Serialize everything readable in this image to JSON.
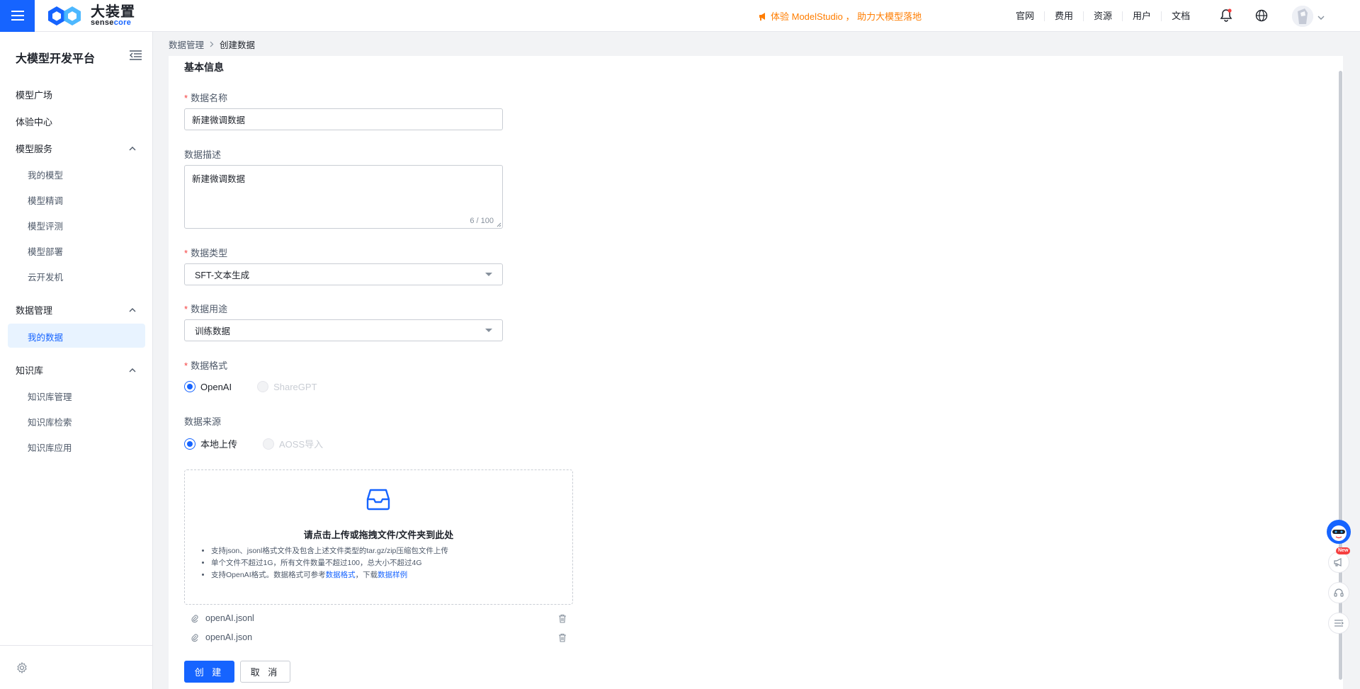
{
  "header": {
    "logo_cn": "大装置",
    "logo_en_a": "sense",
    "logo_en_b": "core",
    "promo": "体验 ModelStudio ， 助力大模型落地",
    "nav": [
      "官网",
      "费用",
      "资源",
      "用户",
      "文档"
    ],
    "accent": "#1664ff",
    "promo_color": "#ff7d00"
  },
  "sidebar": {
    "title": "大模型开发平台",
    "items": {
      "model_square": "模型广场",
      "experience": "体验中心",
      "model_service": "模型服务",
      "my_model": "我的模型",
      "fine_tune": "模型精调",
      "evaluation": "模型评测",
      "deploy": "模型部署",
      "cloud_dev": "云开发机",
      "data_mgmt": "数据管理",
      "my_data": "我的数据",
      "knowledge": "知识库",
      "kb_mgmt": "知识库管理",
      "kb_search": "知识库检索",
      "kb_app": "知识库应用"
    }
  },
  "breadcrumb": {
    "parent": "数据管理",
    "separator": ">",
    "current": "创建数据"
  },
  "form": {
    "section_title": "基本信息",
    "required_mark": "*",
    "name_label": "数据名称",
    "name_value": "新建微调数据",
    "desc_label": "数据描述",
    "desc_value": "新建微调数据",
    "desc_counter": "6 / 100",
    "type_label": "数据类型",
    "type_value": "SFT-文本生成",
    "usage_label": "数据用途",
    "usage_value": "训练数据",
    "format_label": "数据格式",
    "format_options": [
      "OpenAI",
      "ShareGPT"
    ],
    "source_label": "数据来源",
    "source_options": [
      "本地上传",
      "AOSS导入"
    ]
  },
  "upload": {
    "title": "请点击上传或拖拽文件/文件夹到此处",
    "tip1": "支持json、jsonl格式文件及包含上述文件类型的tar.gz/zip压缩包文件上传",
    "tip2": "单个文件不超过1G，所有文件数量不超过100，总大小不超过4G",
    "tip3_a": "支持OpenAI格式。数据格式可参考",
    "tip3_link1": "数据格式",
    "tip3_b": "，下载",
    "tip3_link2": "数据样例"
  },
  "files": [
    "openAI.jsonl",
    "openAI.json"
  ],
  "actions": {
    "create": "创 建",
    "cancel": "取 消"
  },
  "float": {
    "new_badge": "New"
  }
}
